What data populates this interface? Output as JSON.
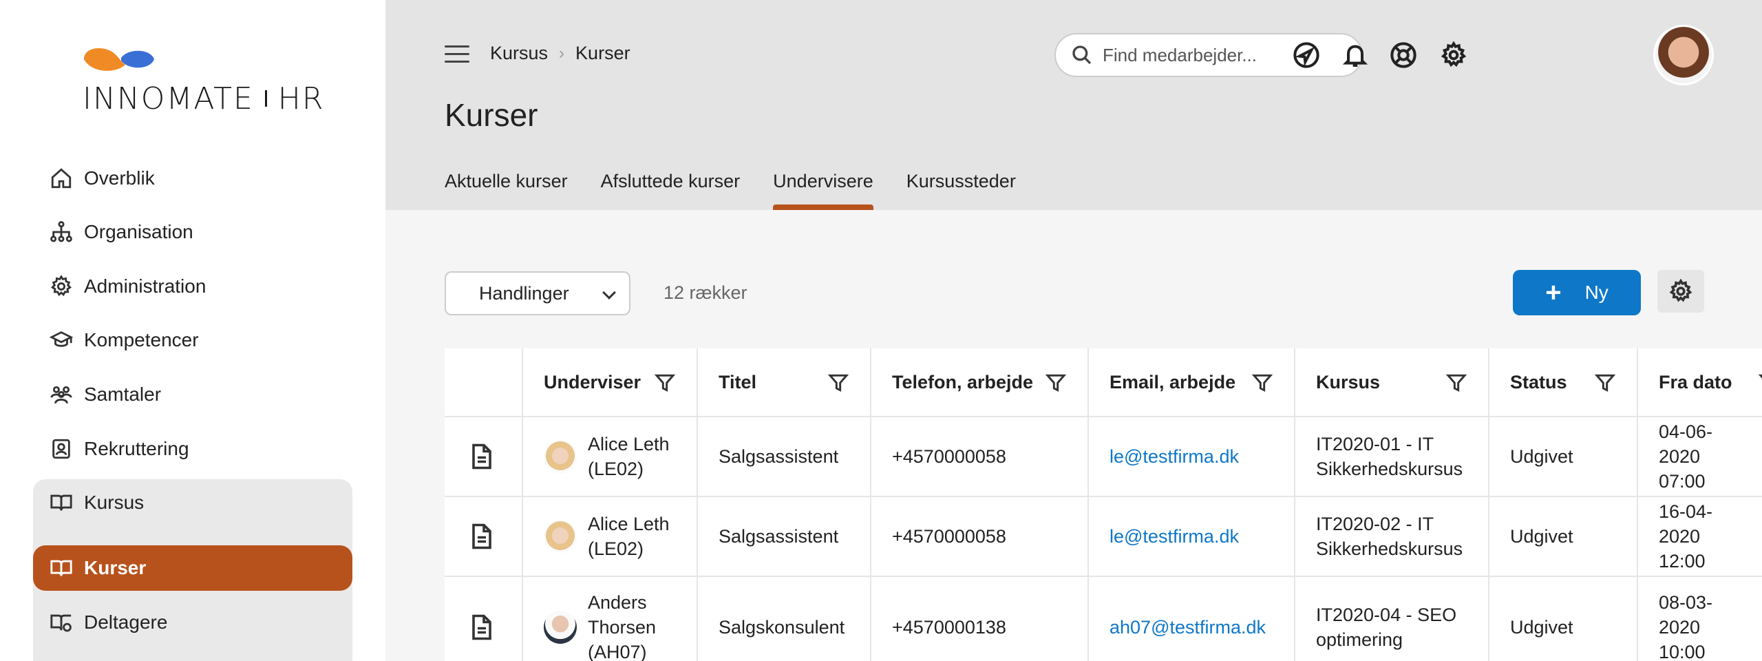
{
  "sidebar": {
    "logo_text_left": "INNOMATE",
    "logo_text_right": "HR",
    "items": [
      {
        "label": "Overblik",
        "icon": "home-icon"
      },
      {
        "label": "Organisation",
        "icon": "org-chart-icon"
      },
      {
        "label": "Administration",
        "icon": "gear-icon"
      },
      {
        "label": "Kompetencer",
        "icon": "graduation-cap-icon"
      },
      {
        "label": "Samtaler",
        "icon": "people-icon"
      },
      {
        "label": "Rekruttering",
        "icon": "id-badge-icon"
      },
      {
        "label": "Kursus",
        "icon": "book-icon"
      },
      {
        "label": "Kurser",
        "icon": "book-icon"
      },
      {
        "label": "Deltagere",
        "icon": "book-person-icon"
      }
    ],
    "active_item": "Kurser",
    "accent_color": "#b8521c"
  },
  "header": {
    "breadcrumb": [
      "Kursus",
      "Kurser"
    ],
    "title": "Kurser",
    "search_placeholder": "Find medarbejder...",
    "icons": [
      "navigation-icon",
      "bell-icon",
      "lifebuoy-icon",
      "gear-icon"
    ],
    "tabs": [
      "Aktuelle kurser",
      "Afsluttede kurser",
      "Undervisere",
      "Kursussteder"
    ],
    "active_tab": "Undervisere"
  },
  "toolbar": {
    "actions_label": "Handlinger",
    "row_count": "12 rækker",
    "new_label": "Ny",
    "primary_color": "#0e77c8"
  },
  "table": {
    "columns": [
      "",
      "Underviser",
      "Titel",
      "Telefon, arbejde",
      "Email, arbejde",
      "Kursus",
      "Status",
      "Fra dato"
    ],
    "rows": [
      {
        "underviser": "Alice Leth (LE02)",
        "titel": "Salgsassistent",
        "telefon": "+4570000058",
        "email": "le@testfirma.dk",
        "kursus": "IT2020-01 - IT Sikkerhedskursus",
        "status": "Udgivet",
        "fra_dato": "04-06-2020 07:00"
      },
      {
        "underviser": "Alice Leth (LE02)",
        "titel": "Salgsassistent",
        "telefon": "+4570000058",
        "email": "le@testfirma.dk",
        "kursus": "IT2020-02 - IT Sikkerhedskursus",
        "status": "Udgivet",
        "fra_dato": "16-04-2020 12:00"
      },
      {
        "underviser": "Anders Thorsen (AH07)",
        "titel": "Salgskonsulent",
        "telefon": "+4570000138",
        "email": "ah07@testfirma.dk",
        "kursus": "IT2020-04 - SEO optimering",
        "status": "Udgivet",
        "fra_dato": "08-03-2020 10:00"
      }
    ]
  }
}
